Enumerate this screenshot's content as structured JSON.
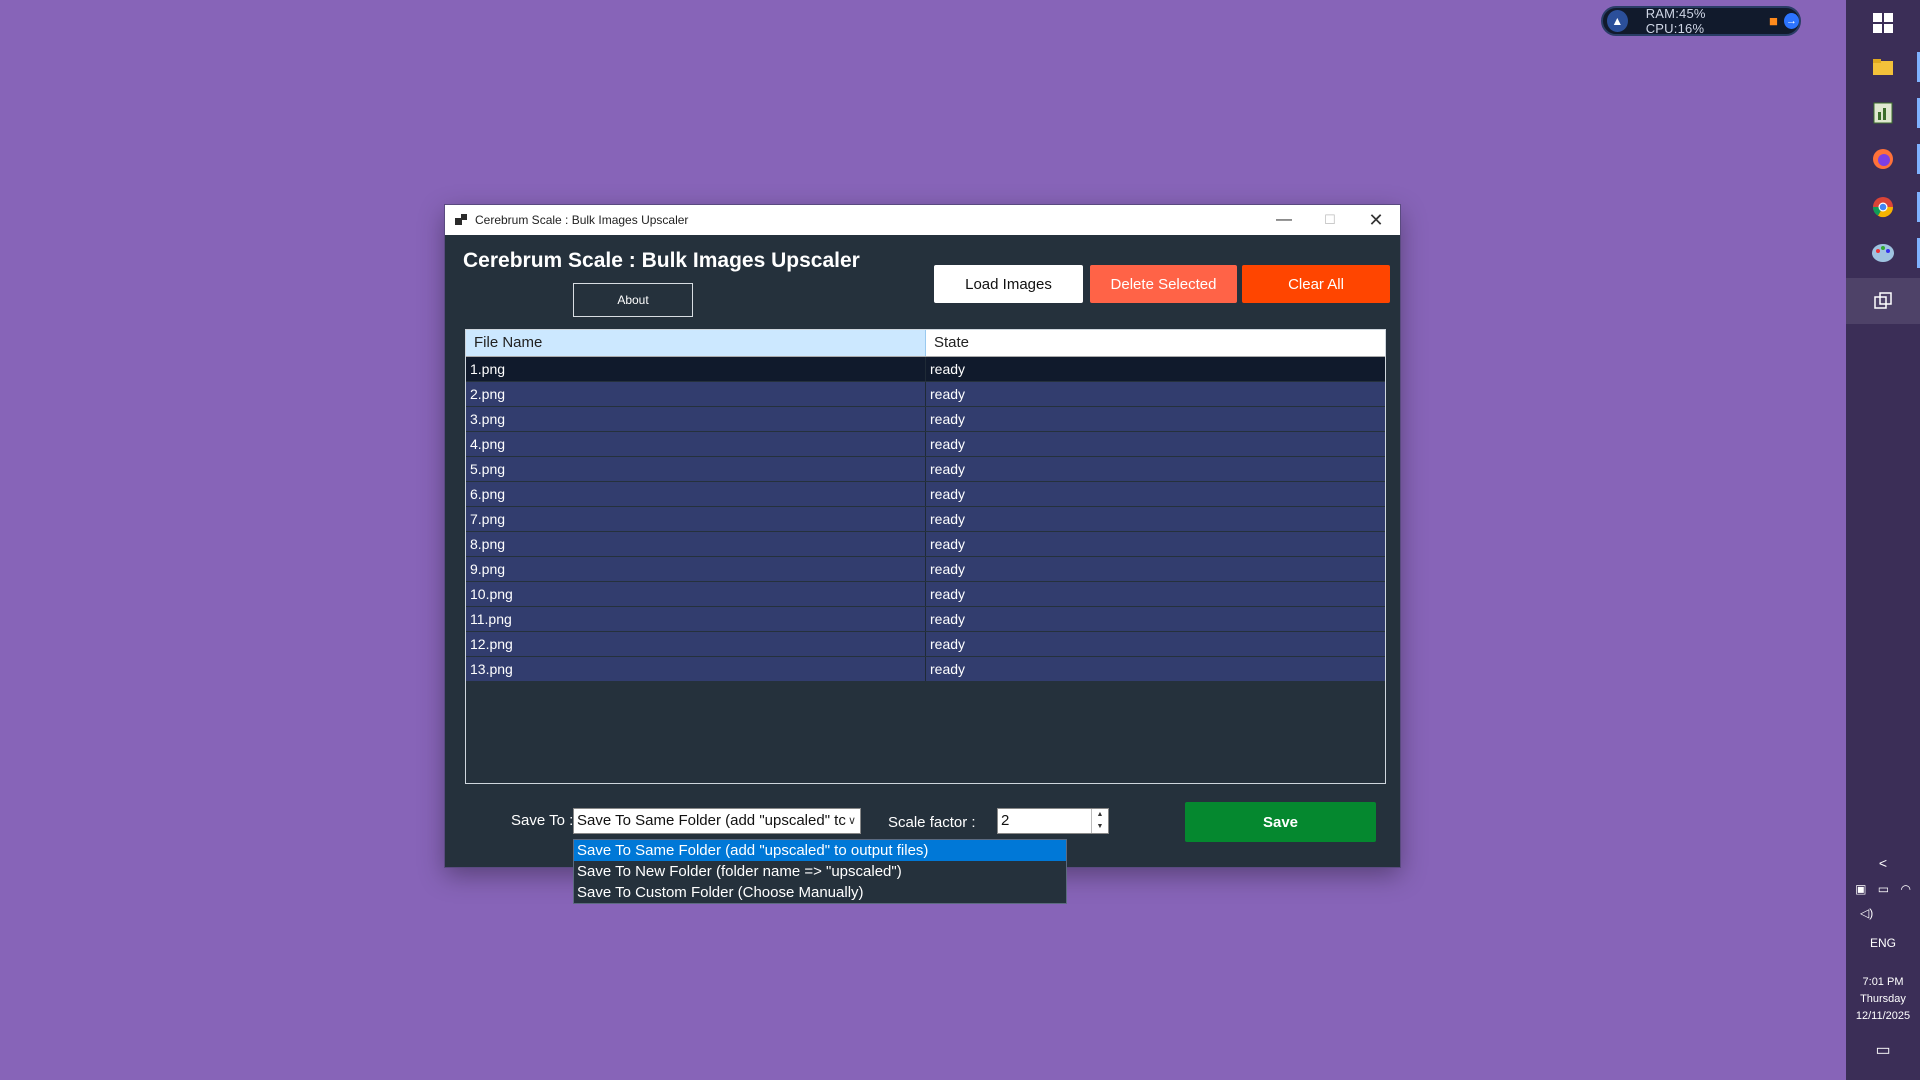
{
  "monitor": {
    "text": "RAM:45%  CPU:16%"
  },
  "taskbar": {
    "tray": {
      "language": "ENG",
      "time": "7:01 PM",
      "day": "Thursday",
      "date": "12/11/2025"
    }
  },
  "window": {
    "title": "Cerebrum Scale : Bulk Images Upscaler",
    "header_title": "Cerebrum Scale : Bulk Images Upscaler",
    "about_label": "About",
    "load_label": "Load Images",
    "delete_label": "Delete Selected",
    "clear_label": "Clear All",
    "table": {
      "headers": [
        "File Name",
        "State"
      ],
      "rows": [
        [
          "1.png",
          "ready"
        ],
        [
          "2.png",
          "ready"
        ],
        [
          "3.png",
          "ready"
        ],
        [
          "4.png",
          "ready"
        ],
        [
          "5.png",
          "ready"
        ],
        [
          "6.png",
          "ready"
        ],
        [
          "7.png",
          "ready"
        ],
        [
          "8.png",
          "ready"
        ],
        [
          "9.png",
          "ready"
        ],
        [
          "10.png",
          "ready"
        ],
        [
          "11.png",
          "ready"
        ],
        [
          "12.png",
          "ready"
        ],
        [
          "13.png",
          "ready"
        ]
      ]
    },
    "save_to_label": "Save To :",
    "save_to_value": "Save To Same Folder (add \"upscaled\" tc",
    "save_options": [
      "Save To Same Folder (add \"upscaled\" to output files)",
      "Save To New Folder (folder name => \"upscaled\")",
      "Save To Custom Folder (Choose Manually)"
    ],
    "scale_label": "Scale factor :",
    "scale_value": "2",
    "save_label": "Save"
  },
  "colors": {
    "desktop": "#8764b8",
    "window_bg": "#25313c",
    "row_bg": "#323d6e",
    "delete": "#ff6347",
    "clear": "#ff4500",
    "save": "#05882f",
    "highlight": "#0078d7"
  }
}
